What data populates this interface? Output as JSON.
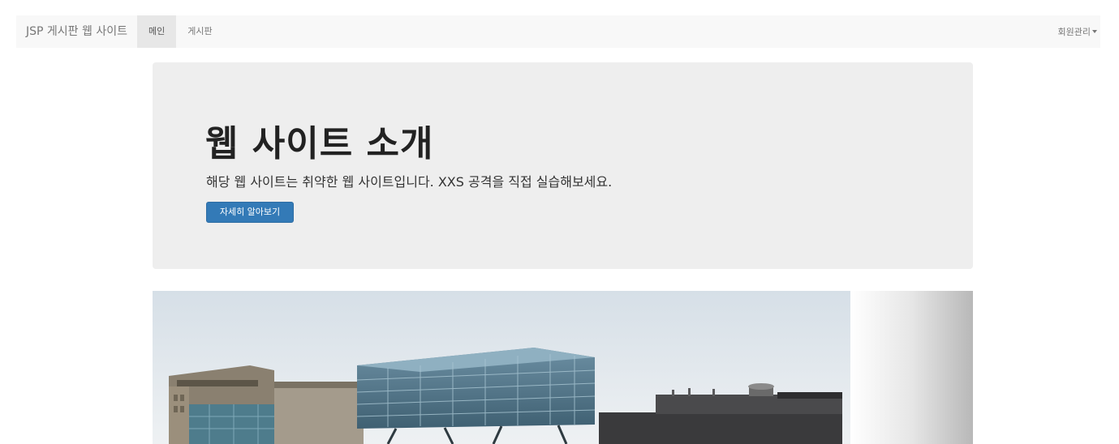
{
  "navbar": {
    "brand": "JSP 게시판 웹 사이트",
    "items": [
      {
        "label": "메인",
        "active": true
      },
      {
        "label": "게시판",
        "active": false
      }
    ],
    "right_menu": "회원관리"
  },
  "jumbotron": {
    "title": "웹 사이트 소개",
    "text": "해당 웹 사이트는 취약한 웹 사이트입니다. XXS 공격을 직접 실습해보세요.",
    "button_label": "자세히 알아보기"
  },
  "carousel": {
    "image": "campus-building-photo"
  },
  "colors": {
    "primary": "#337ab7",
    "navbar_bg": "#f8f8f8",
    "jumbotron_bg": "#eeeeee"
  }
}
